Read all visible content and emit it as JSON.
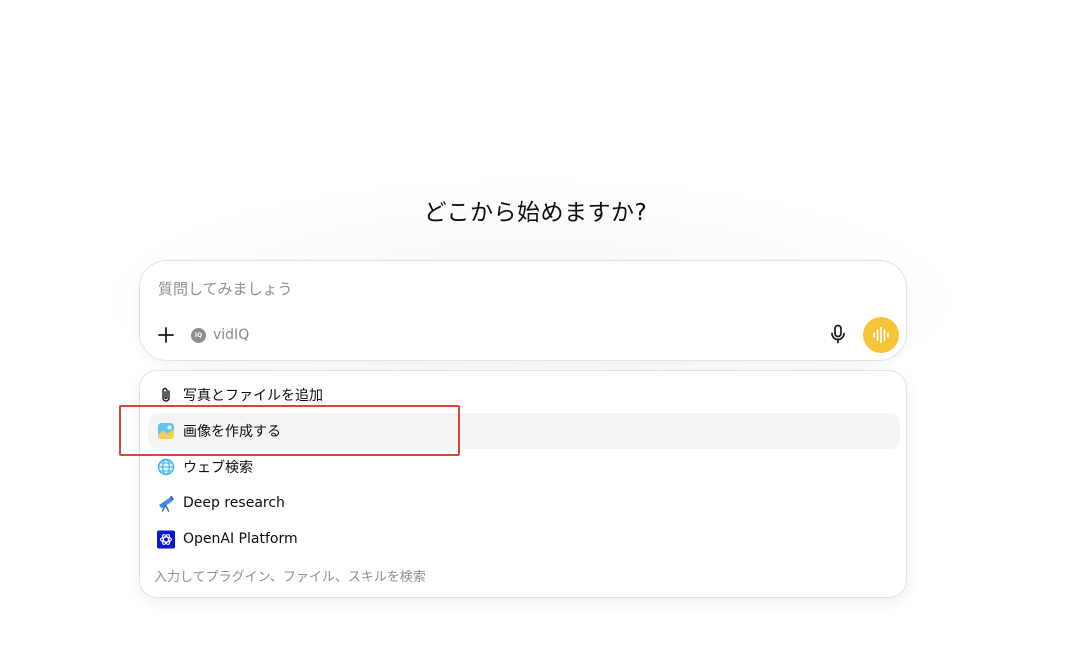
{
  "headline": "どこから始めますか?",
  "composer": {
    "placeholder": "質問してみましょう",
    "value": "",
    "plugin_chip": {
      "icon_text": "iQ",
      "label": "vidIQ"
    },
    "icons": {
      "plus": "plus-icon",
      "mic": "microphone-icon",
      "voice": "voice-waveform-icon"
    },
    "voice_color": "#f4c43a"
  },
  "menu": {
    "items": [
      {
        "label": "写真とファイルを追加",
        "icon": "paperclip-icon",
        "active": false
      },
      {
        "label": "画像を作成する",
        "icon": "image-icon",
        "active": true
      },
      {
        "label": "ウェブ検索",
        "icon": "globe-icon",
        "active": false
      },
      {
        "label": "Deep research",
        "icon": "telescope-icon",
        "active": false
      },
      {
        "label": "OpenAI Platform",
        "icon": "openai-logo-icon",
        "active": false
      }
    ],
    "hint": "入力してプラグイン、ファイル、スキルを検索"
  },
  "annotation": {
    "highlight_color": "#d9473b",
    "highlight_target": "画像を作成する"
  }
}
